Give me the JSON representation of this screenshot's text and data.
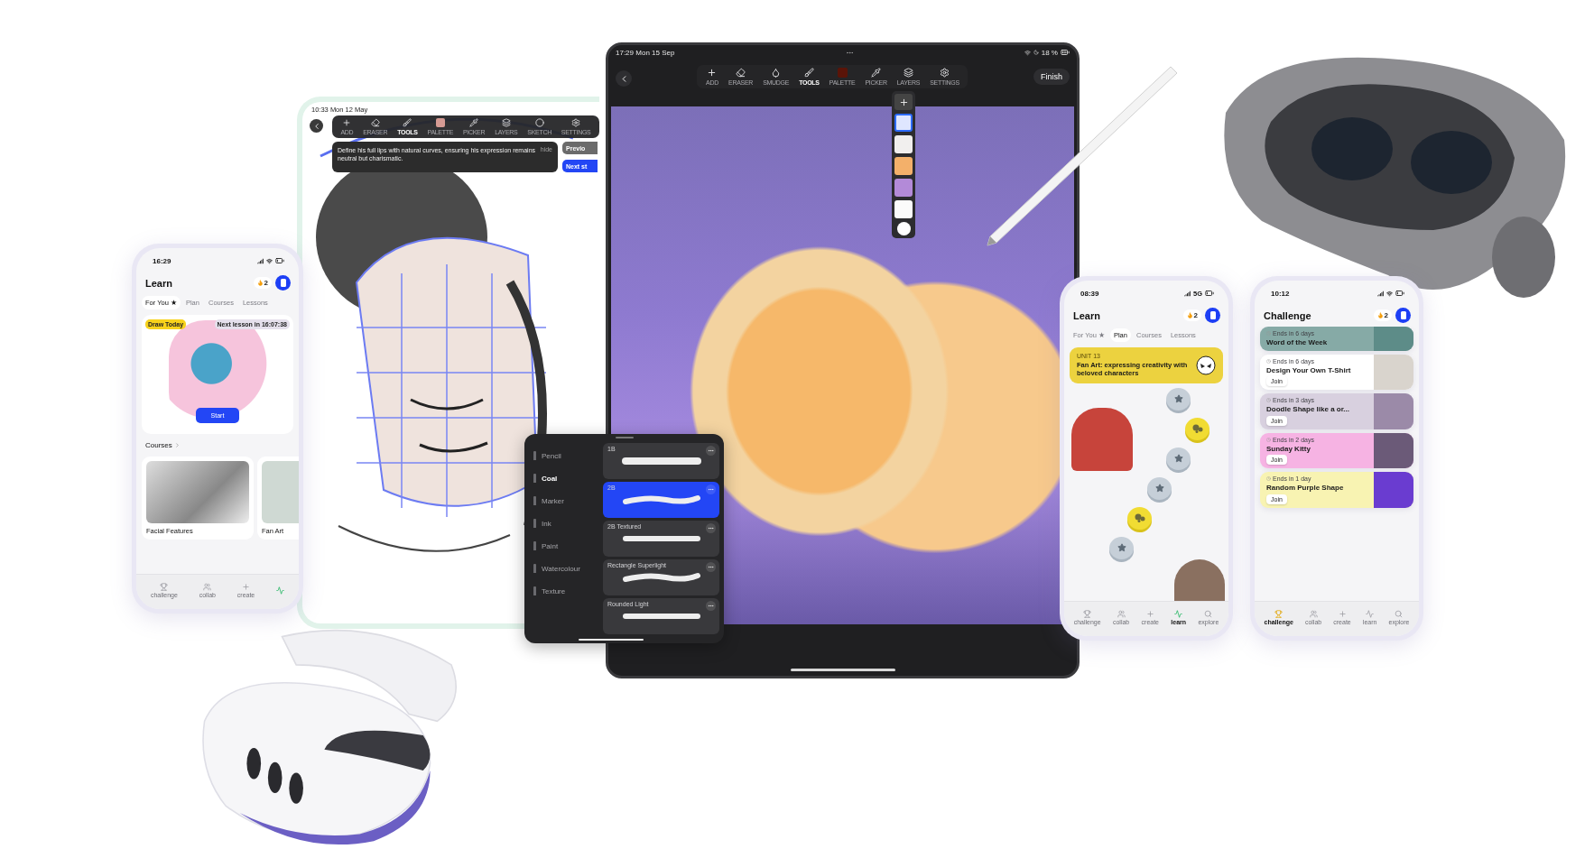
{
  "sketch_tablet": {
    "status_time": "10:33",
    "status_date": "Mon 12 May",
    "toolbar": [
      {
        "kind": "add",
        "label": "ADD",
        "selected": false
      },
      {
        "kind": "eraser",
        "label": "ERASER",
        "selected": false
      },
      {
        "kind": "tools",
        "label": "TOOLS",
        "selected": true
      },
      {
        "kind": "palette",
        "label": "PALETTE",
        "selected": false
      },
      {
        "kind": "picker",
        "label": "PICKER",
        "selected": false
      },
      {
        "kind": "layers",
        "label": "LAYERS",
        "selected": false
      },
      {
        "kind": "sketch",
        "label": "SKETCH",
        "selected": false
      },
      {
        "kind": "settings",
        "label": "SETTINGS",
        "selected": false
      }
    ],
    "tip": {
      "text": "Define his full lips with natural curves, ensuring his expression remains neutral but charismatic.",
      "hide": "hide"
    },
    "buttons": [
      {
        "kind": "secondary",
        "label": "Previo"
      },
      {
        "kind": "primary",
        "label": "Next st"
      }
    ]
  },
  "left_phone": {
    "time": "16:29",
    "title": "Learn",
    "streak": "2",
    "tabs": [
      {
        "label": "For You ★",
        "selected": true
      },
      {
        "label": "Plan",
        "selected": false
      },
      {
        "label": "Courses",
        "selected": false
      },
      {
        "label": "Lessons",
        "selected": false
      }
    ],
    "hero": {
      "badge": "Draw Today",
      "countdown": "Next lesson in 16:07:38",
      "action": "Start"
    },
    "section": "Courses",
    "courses": [
      {
        "title": "Facial Features"
      },
      {
        "title": "Fan Art"
      }
    ],
    "nav": [
      {
        "kind": "challenge",
        "label": "challenge",
        "selected": false
      },
      {
        "kind": "collab",
        "label": "collab",
        "selected": false
      },
      {
        "kind": "create",
        "label": "create",
        "selected": false
      },
      {
        "kind": "learn",
        "selected": true
      }
    ]
  },
  "main_tablet": {
    "status_time": "17:29",
    "status_date": "Mon 15 Sep",
    "battery": "18 %",
    "toolbar": [
      {
        "kind": "add",
        "label": "ADD",
        "selected": false
      },
      {
        "kind": "eraser",
        "label": "ERASER",
        "selected": false
      },
      {
        "kind": "smudge",
        "label": "SMUDGE",
        "selected": false
      },
      {
        "kind": "tools",
        "label": "TOOLS",
        "selected": true
      },
      {
        "kind": "palette",
        "label": "PALETTE",
        "selected": false
      },
      {
        "kind": "picker",
        "label": "PICKER",
        "selected": false
      },
      {
        "kind": "layers",
        "label": "LAYERS",
        "selected": false
      },
      {
        "kind": "settings",
        "label": "SETTINGS",
        "selected": false
      }
    ],
    "finish": "Finish",
    "layers": [
      {
        "selected": true
      },
      {
        "selected": false
      },
      {
        "selected": false
      },
      {
        "selected": false
      },
      {
        "selected": false
      }
    ]
  },
  "brush_panel": {
    "categories": [
      {
        "label": "Pencil",
        "selected": false
      },
      {
        "label": "Coal",
        "selected": true
      },
      {
        "label": "Marker",
        "selected": false
      },
      {
        "label": "Ink",
        "selected": false
      },
      {
        "label": "Paint",
        "selected": false
      },
      {
        "label": "Watercolour",
        "selected": false
      },
      {
        "label": "Texture",
        "selected": false
      }
    ],
    "brushes": [
      {
        "name": "1B",
        "selected": false
      },
      {
        "name": "2B",
        "selected": true
      },
      {
        "name": "2B Textured",
        "selected": false
      },
      {
        "name": "Rectangle Superlight",
        "selected": false
      },
      {
        "name": "Rounded Light",
        "selected": false
      }
    ]
  },
  "learn_phone": {
    "time": "08:39",
    "network": "5G",
    "title": "Learn",
    "streak": "2",
    "tabs": [
      {
        "label": "For You ★",
        "selected": false
      },
      {
        "label": "Plan",
        "selected": true
      },
      {
        "label": "Courses",
        "selected": false
      },
      {
        "label": "Lessons",
        "selected": false
      }
    ],
    "unit": {
      "label": "UNIT 13",
      "title": "Fan Art: expressing creativity with beloved characters"
    },
    "path": [
      {
        "kind": "star"
      },
      {
        "kind": "practice"
      },
      {
        "kind": "star"
      },
      {
        "kind": "star"
      },
      {
        "kind": "practice"
      },
      {
        "kind": "star"
      }
    ],
    "nav": [
      {
        "kind": "challenge",
        "label": "challenge",
        "selected": false
      },
      {
        "kind": "collab",
        "label": "collab",
        "selected": false
      },
      {
        "kind": "create",
        "label": "create",
        "selected": false
      },
      {
        "kind": "learn",
        "label": "learn",
        "selected": true
      },
      {
        "kind": "explore",
        "label": "explore",
        "selected": false
      }
    ]
  },
  "challenge_phone": {
    "time": "10:12",
    "title": "Challenge",
    "streak": "2",
    "challenges": [
      {
        "ends": "Ends in 6 days",
        "title": "Word of the Week",
        "color": "#86aaa6"
      },
      {
        "ends": "Ends in 6 days",
        "title": "Design Your Own T-Shirt",
        "action": "Join",
        "color": "#ffffff"
      },
      {
        "ends": "Ends in 3 days",
        "title": "Doodle Shape like a or...",
        "action": "Join",
        "color": "#d8d0df"
      },
      {
        "ends": "Ends in 2 days",
        "title": "Sunday Kitty",
        "action": "Join",
        "color": "#f6b3e3"
      },
      {
        "ends": "Ends in 1 day",
        "title": "Random Purple Shape",
        "action": "Join",
        "color": "#f8f3b2"
      }
    ],
    "nav": [
      {
        "kind": "challenge",
        "label": "challenge",
        "selected": true
      },
      {
        "kind": "collab",
        "label": "collab",
        "selected": false
      },
      {
        "kind": "create",
        "label": "create",
        "selected": false
      },
      {
        "kind": "learn",
        "label": "learn",
        "selected": false
      },
      {
        "kind": "explore",
        "label": "explore",
        "selected": false
      }
    ]
  }
}
